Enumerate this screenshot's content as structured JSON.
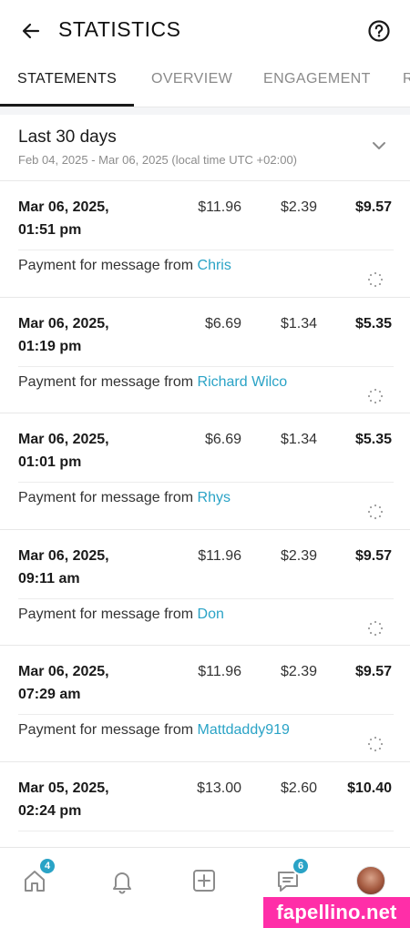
{
  "header": {
    "title": "STATISTICS",
    "back_icon": "arrow-left-icon",
    "help_icon": "question-circle-icon"
  },
  "tabs": [
    {
      "label": "STATEMENTS",
      "active": true
    },
    {
      "label": "OVERVIEW",
      "active": false
    },
    {
      "label": "ENGAGEMENT",
      "active": false
    },
    {
      "label": "R",
      "active": false
    }
  ],
  "period": {
    "title": "Last 30 days",
    "subtitle": "Feb 04, 2025 - Mar 06, 2025 (local time UTC +02:00)"
  },
  "statements": [
    {
      "date": "Mar 06, 2025,",
      "time": "01:51 pm",
      "gross": "$11.96",
      "fee": "$2.39",
      "net": "$9.57",
      "desc": "Payment for message from ",
      "from": "Chris"
    },
    {
      "date": "Mar 06, 2025,",
      "time": "01:19 pm",
      "gross": "$6.69",
      "fee": "$1.34",
      "net": "$5.35",
      "desc": "Payment for message from ",
      "from": "Richard Wilco"
    },
    {
      "date": "Mar 06, 2025,",
      "time": "01:01 pm",
      "gross": "$6.69",
      "fee": "$1.34",
      "net": "$5.35",
      "desc": "Payment for message from ",
      "from": "Rhys"
    },
    {
      "date": "Mar 06, 2025,",
      "time": "09:11 am",
      "gross": "$11.96",
      "fee": "$2.39",
      "net": "$9.57",
      "desc": "Payment for message from ",
      "from": "Don"
    },
    {
      "date": "Mar 06, 2025,",
      "time": "07:29 am",
      "gross": "$11.96",
      "fee": "$2.39",
      "net": "$9.57",
      "desc": "Payment for message from ",
      "from": "Mattdaddy919"
    },
    {
      "date": "Mar 05, 2025,",
      "time": "02:24 pm",
      "gross": "$13.00",
      "fee": "$2.60",
      "net": "$10.40",
      "desc": "",
      "from": ""
    }
  ],
  "bottom_nav": {
    "home_badge": "4",
    "messages_badge": "6"
  },
  "watermark": "fapellino.net",
  "colors": {
    "accent": "#2aa3c6",
    "watermark": "#ff2ea8"
  }
}
